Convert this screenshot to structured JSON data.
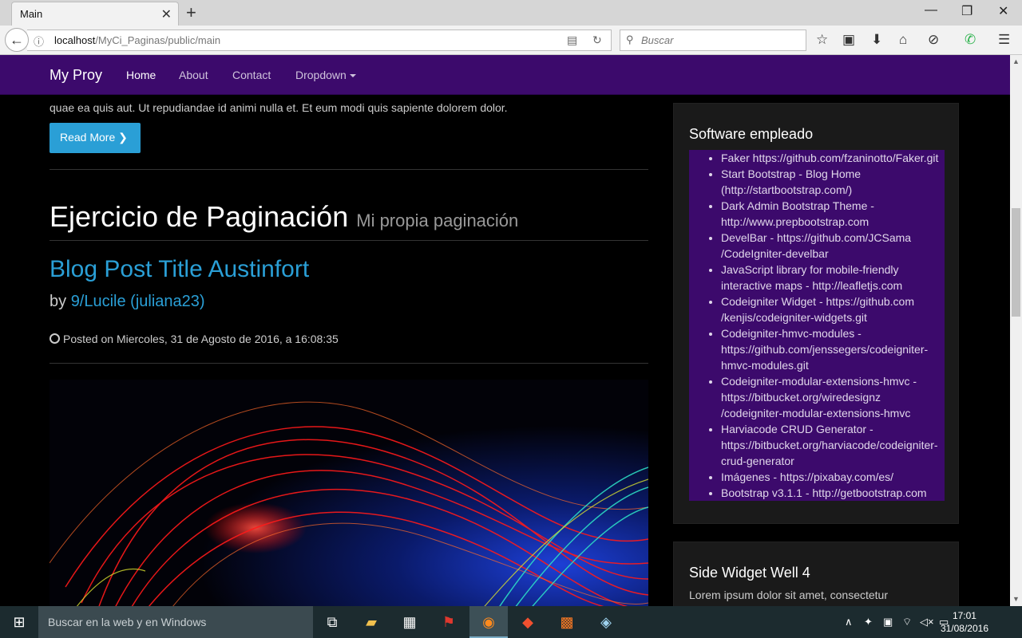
{
  "browser": {
    "tab_title": "Main",
    "url_host": "localhost",
    "url_path": "/MyCi_Paginas/public/main",
    "search_placeholder": "Buscar"
  },
  "site": {
    "brand": "My Proy",
    "nav": [
      "Home",
      "About",
      "Contact",
      "Dropdown"
    ]
  },
  "content": {
    "excerpt": "quae ea quis aut. Ut repudiandae id animi nulla et. Et eum modi quis sapiente dolorem dolor.",
    "read_more": "Read More",
    "page_title": "Ejercicio de Paginación",
    "page_subtitle": "Mi propia paginación",
    "post_title": "Blog Post Title Austinfort",
    "post_by_prefix": "by",
    "post_author": "9/Lucile (juliana23)",
    "posted_on": "Posted on Miercoles, 31 de Agosto de 2016, a 16:08:35"
  },
  "sidebar": {
    "software_title": "Software empleado",
    "software_items": [
      "Faker https://github.com/fzaninotto/Faker.git",
      "Start Bootstrap - Blog Home (http://startbootstrap.com/)",
      "Dark Admin Bootstrap Theme - http://www.prepbootstrap.com",
      "DevelBar - https://github.com/JCSama /CodeIgniter-develbar",
      "JavaScript library for mobile-friendly interactive maps - http://leafletjs.com",
      "Codeigniter Widget - https://github.com /kenjis/codeigniter-widgets.git",
      "Codeigniter-hmvc-modules - https://github.com/jenssegers/codeigniter-hmvc-modules.git",
      "Codeigniter-modular-extensions-hmvc - https://bitbucket.org/wiredesignz /codeigniter-modular-extensions-hmvc",
      "Harviacode CRUD Generator - https://bitbucket.org/harviacode/codeigniter-crud-generator",
      "Imágenes - https://pixabay.com/es/",
      "Bootstrap v3.1.1 - http://getbootstrap.com"
    ],
    "well4_title": "Side Widget Well 4",
    "well4_text": "Lorem ipsum dolor sit amet, consectetur"
  },
  "taskbar": {
    "search_text": "Buscar en la web y en Windows",
    "time": "17:01",
    "date": "31/08/2016"
  }
}
